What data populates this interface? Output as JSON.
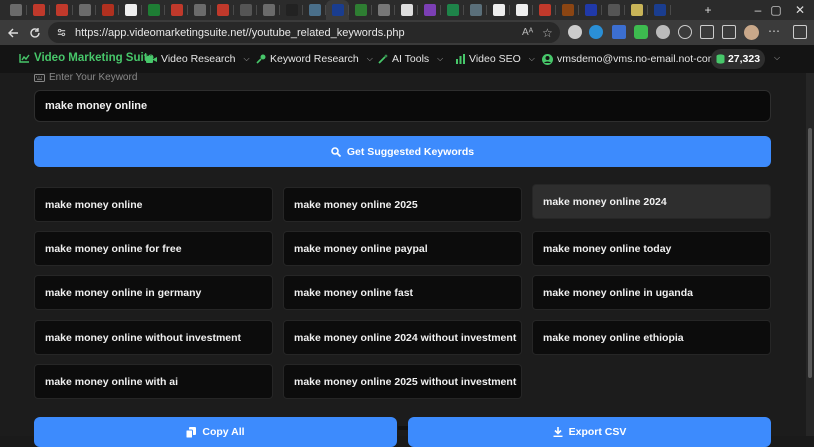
{
  "browser": {
    "url": "https://app.videomarketingsuite.net//youtube_related_keywords.php",
    "new_tab_label": "+",
    "window_controls": [
      "–",
      "▢",
      "✕"
    ],
    "tab_favicons": [
      {
        "icon": "globe-icon",
        "color": "#6b6b6b"
      },
      {
        "icon": "link-icon",
        "color": "#c0392b"
      },
      {
        "icon": "link-icon",
        "color": "#c0392b"
      },
      {
        "icon": "globe-icon",
        "color": "#6b6b6b"
      },
      {
        "icon": "red-app-icon",
        "color": "#b0301f"
      },
      {
        "icon": "white-app-icon",
        "color": "#eeeeee"
      },
      {
        "icon": "leaf-icon",
        "color": "#1e7e34"
      },
      {
        "icon": "red-target-icon",
        "color": "#c0392b"
      },
      {
        "icon": "share-icon",
        "color": "#6b6b6b"
      },
      {
        "icon": "link-icon",
        "color": "#c0392b"
      },
      {
        "icon": "face-icon",
        "color": "#555555"
      },
      {
        "icon": "globe-icon",
        "color": "#6b6b6b"
      },
      {
        "icon": "dark-app-icon",
        "color": "#222222"
      },
      {
        "icon": "image-icon",
        "color": "#4a6f8a"
      },
      {
        "icon": "vms-icon",
        "color": "#1a3d8f"
      },
      {
        "icon": "green-app-icon",
        "color": "#2e7d32"
      },
      {
        "icon": "note-icon",
        "color": "#777777"
      },
      {
        "icon": "doc-icon",
        "color": "#dddddd"
      },
      {
        "icon": "list-icon",
        "color": "#7b3fb5"
      },
      {
        "icon": "sheet-icon",
        "color": "#1e8449"
      },
      {
        "icon": "image-icon",
        "color": "#5a6f7a"
      },
      {
        "icon": "github-icon",
        "color": "#eeeeee"
      },
      {
        "icon": "github-icon",
        "color": "#eeeeee"
      },
      {
        "icon": "red-app-icon",
        "color": "#c0392b"
      },
      {
        "icon": "brown-app-icon",
        "color": "#8b4513"
      },
      {
        "icon": "flag-icon",
        "color": "#2039a8"
      },
      {
        "icon": "tool-icon",
        "color": "#555555"
      },
      {
        "icon": "yellow-app-icon",
        "color": "#c9b458"
      },
      {
        "icon": "vms-icon",
        "color": "#1a3d8f"
      }
    ]
  },
  "app": {
    "brand": "Video Marketing Suite",
    "menus": [
      {
        "label": "Video Research",
        "icon": "video-camera-icon"
      },
      {
        "label": "Keyword Research",
        "icon": "key-icon"
      },
      {
        "label": "AI Tools",
        "icon": "magic-wand-icon"
      },
      {
        "label": "Video SEO",
        "icon": "bar-chart-icon"
      }
    ],
    "user_email": "vmsdemo@vms.no-email.not-com",
    "credits": "27,323"
  },
  "form": {
    "label": "Enter Your Keyword",
    "keyword_value": "make money online",
    "suggest_button": "Get Suggested Keywords"
  },
  "suggestions": [
    "make money online",
    "make money online 2025",
    "make money online 2024",
    "make money online for free",
    "make money online paypal",
    "make money online today",
    "make money online in germany",
    "make money online fast",
    "make money online in uganda",
    "make money online without investment",
    "make money online 2024 without investment",
    "make money online ethiopia",
    "make money online with ai",
    "make money online 2025 without investment"
  ],
  "actions": {
    "copy_all": "Copy All",
    "export_csv": "Export CSV"
  },
  "colors": {
    "brand_green": "#47c76a",
    "primary_blue": "#3d8bfd",
    "background": "#1c1c1c"
  }
}
